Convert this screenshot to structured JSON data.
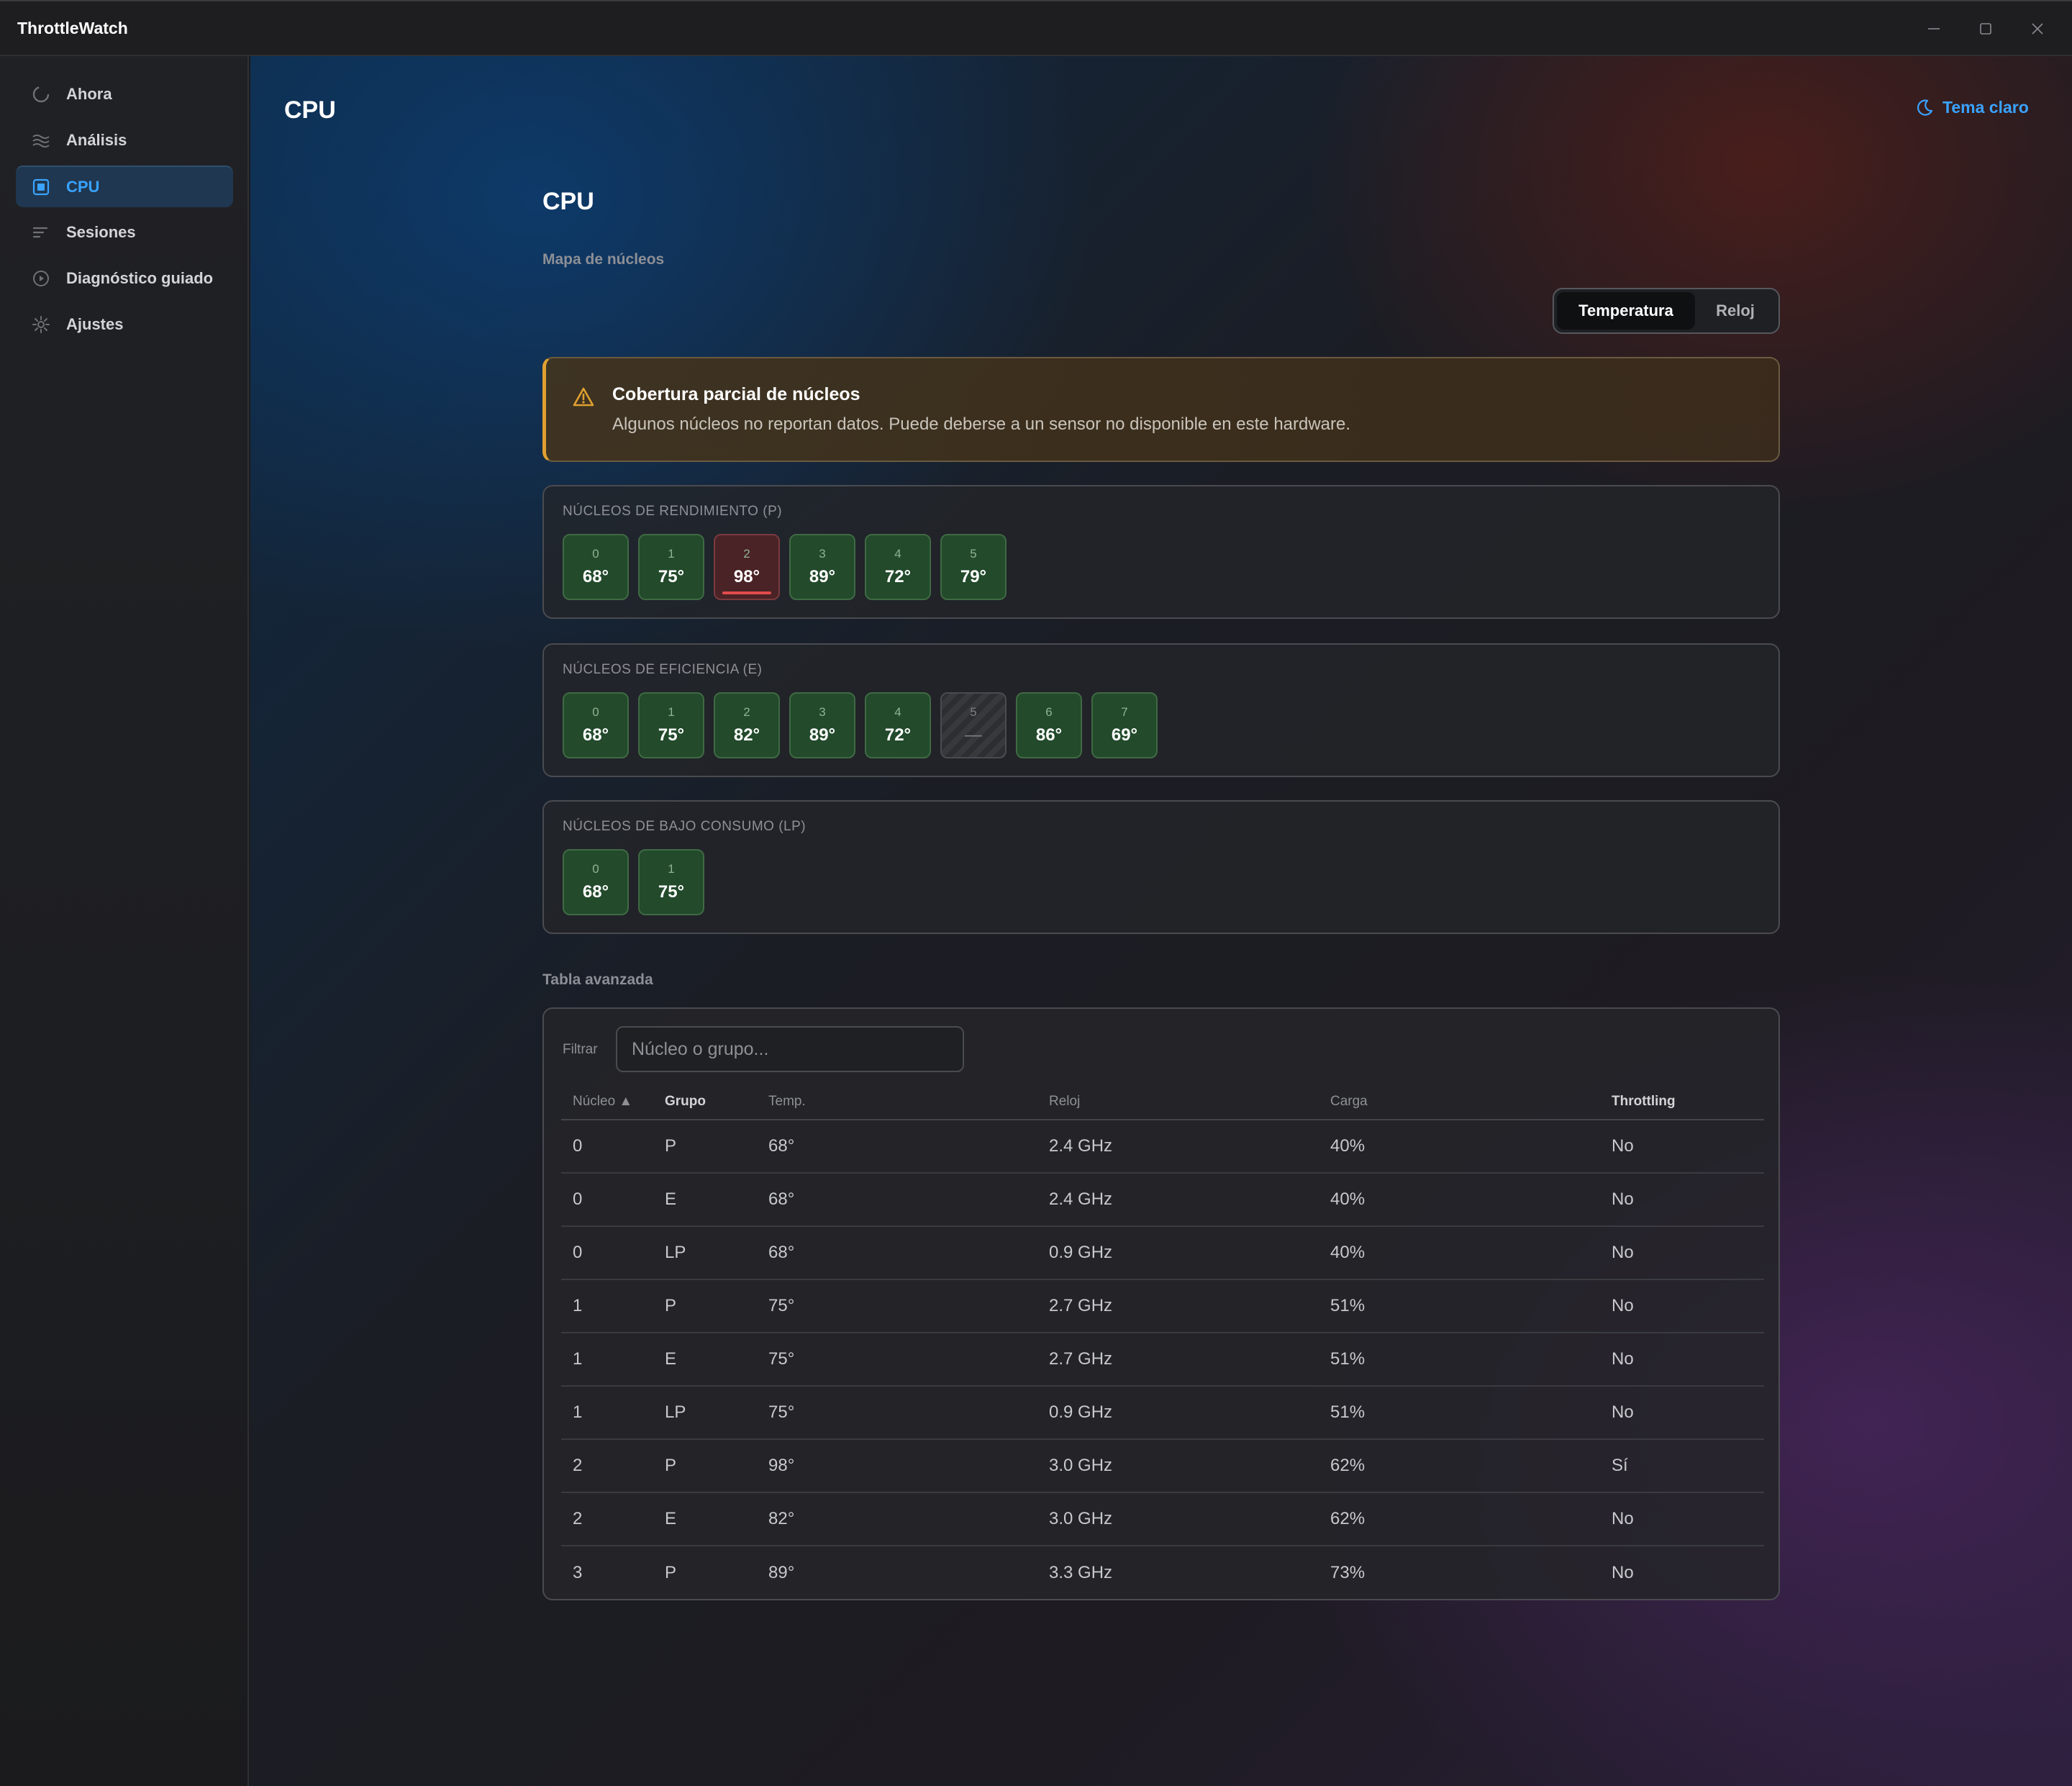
{
  "app": {
    "title": "ThrottleWatch"
  },
  "window_controls": [
    "minimize-icon",
    "maximize-icon",
    "close-icon"
  ],
  "sidebar": {
    "items": [
      {
        "label": "Ahora",
        "icon": "loading-circle-icon",
        "active": false
      },
      {
        "label": "Análisis",
        "icon": "waves-icon",
        "active": false
      },
      {
        "label": "CPU",
        "icon": "cpu-icon",
        "active": true
      },
      {
        "label": "Sesiones",
        "icon": "list-lines-icon",
        "active": false
      },
      {
        "label": "Diagnóstico guiado",
        "icon": "play-circle-icon",
        "active": false
      },
      {
        "label": "Ajustes",
        "icon": "gear-icon",
        "active": false
      }
    ]
  },
  "header": {
    "title": "CPU",
    "theme_toggle": "Tema claro"
  },
  "content": {
    "title": "CPU",
    "core_map_label": "Mapa de núcleos",
    "view_toggle": {
      "options": [
        "Temperatura",
        "Reloj"
      ],
      "selected": "Temperatura"
    },
    "warning": {
      "title": "Cobertura parcial de núcleos",
      "text": "Algunos núcleos no reportan datos. Puede deberse a un sensor no disponible en este hardware."
    },
    "groups": [
      {
        "label": "NÚCLEOS DE RENDIMIENTO (P)",
        "cores": [
          {
            "id": "0",
            "value": "68°",
            "state": "ok"
          },
          {
            "id": "1",
            "value": "75°",
            "state": "ok"
          },
          {
            "id": "2",
            "value": "98°",
            "state": "hot"
          },
          {
            "id": "3",
            "value": "89°",
            "state": "ok"
          },
          {
            "id": "4",
            "value": "72°",
            "state": "ok"
          },
          {
            "id": "5",
            "value": "79°",
            "state": "ok"
          }
        ]
      },
      {
        "label": "NÚCLEOS DE EFICIENCIA (E)",
        "cores": [
          {
            "id": "0",
            "value": "68°",
            "state": "ok"
          },
          {
            "id": "1",
            "value": "75°",
            "state": "ok"
          },
          {
            "id": "2",
            "value": "82°",
            "state": "ok"
          },
          {
            "id": "3",
            "value": "89°",
            "state": "ok"
          },
          {
            "id": "4",
            "value": "72°",
            "state": "ok"
          },
          {
            "id": "5",
            "value": "—",
            "state": "missing"
          },
          {
            "id": "6",
            "value": "86°",
            "state": "ok"
          },
          {
            "id": "7",
            "value": "69°",
            "state": "ok"
          }
        ]
      },
      {
        "label": "NÚCLEOS DE BAJO CONSUMO (LP)",
        "cores": [
          {
            "id": "0",
            "value": "68°",
            "state": "ok"
          },
          {
            "id": "1",
            "value": "75°",
            "state": "ok"
          }
        ]
      }
    ],
    "advanced_table_label": "Tabla avanzada",
    "filter": {
      "label": "Filtrar",
      "placeholder": "Núcleo o grupo..."
    },
    "table": {
      "columns": [
        "Núcleo ▲",
        "Grupo",
        "Temp.",
        "Reloj",
        "Carga",
        "Throttling"
      ],
      "rows": [
        [
          "0",
          "P",
          "68°",
          "2.4 GHz",
          "40%",
          "No"
        ],
        [
          "0",
          "E",
          "68°",
          "2.4 GHz",
          "40%",
          "No"
        ],
        [
          "0",
          "LP",
          "68°",
          "0.9 GHz",
          "40%",
          "No"
        ],
        [
          "1",
          "P",
          "75°",
          "2.7 GHz",
          "51%",
          "No"
        ],
        [
          "1",
          "E",
          "75°",
          "2.7 GHz",
          "51%",
          "No"
        ],
        [
          "1",
          "LP",
          "75°",
          "0.9 GHz",
          "51%",
          "No"
        ],
        [
          "2",
          "P",
          "98°",
          "3.0 GHz",
          "62%",
          "Sí"
        ],
        [
          "2",
          "E",
          "82°",
          "3.0 GHz",
          "62%",
          "No"
        ],
        [
          "3",
          "P",
          "89°",
          "3.3 GHz",
          "73%",
          "No"
        ]
      ]
    }
  },
  "colors": {
    "accent": "#3aa3ff",
    "core_ok": "#224a2b",
    "core_hot": "#4a2326",
    "hot_indicator": "#e24b4b",
    "warning": "#e0a030"
  }
}
